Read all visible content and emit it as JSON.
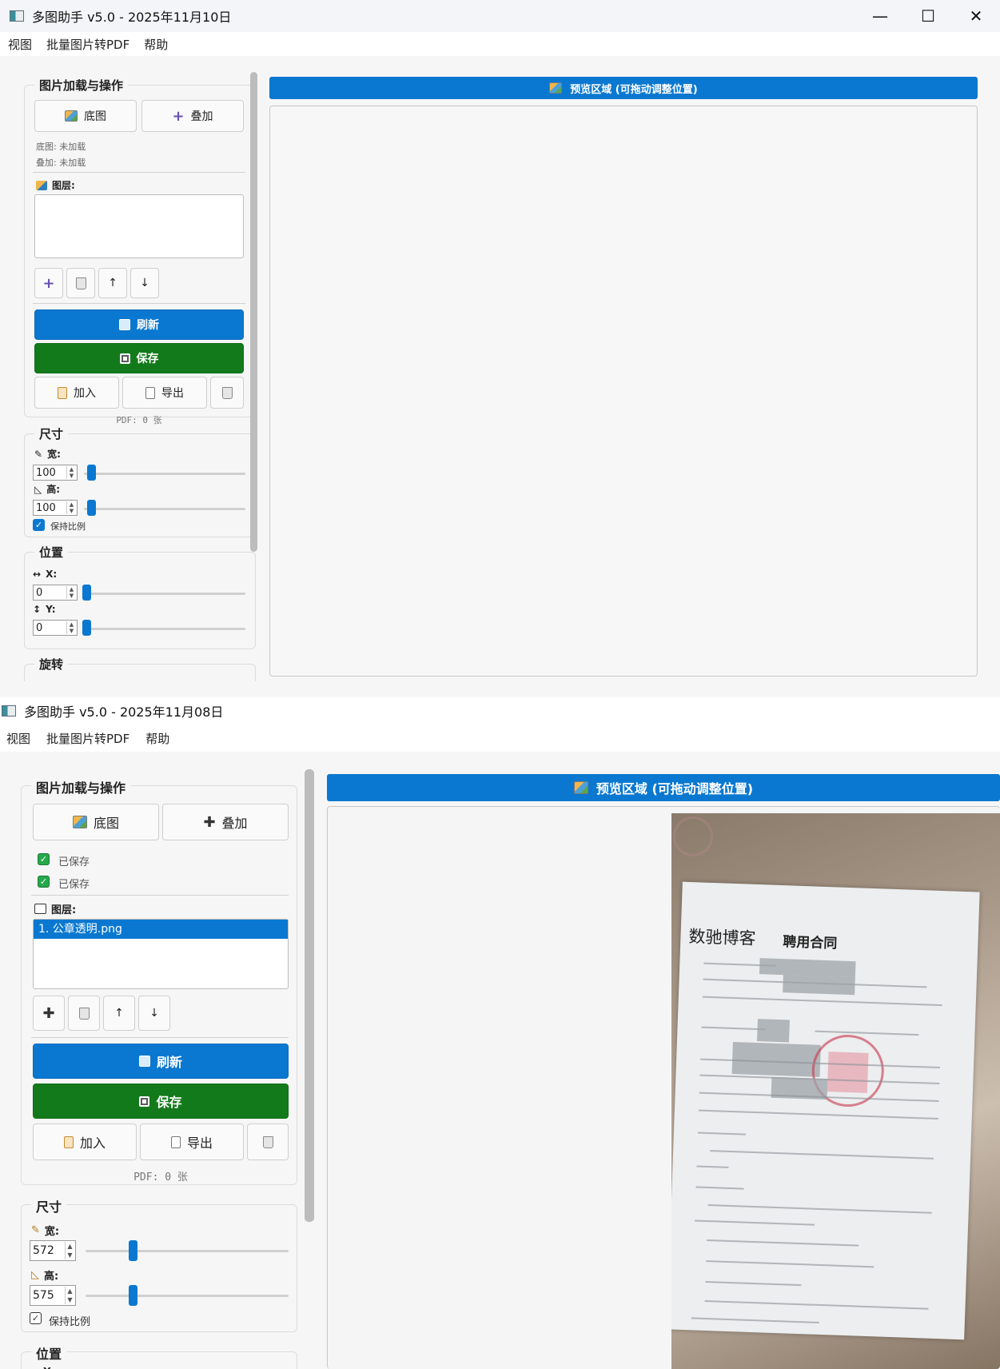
{
  "top": {
    "title": "多图助手 v5.0 - 2025年11月10日",
    "menu": [
      "视图",
      "批量图片转PDF",
      "帮助"
    ],
    "group_load": "图片加载与操作",
    "btn_base": "底图",
    "btn_overlay": "叠加",
    "status_base": "底图: 未加载",
    "status_overlay": "叠加: 未加载",
    "layers_label": "图层:",
    "btn_refresh": "刷新",
    "btn_save": "保存",
    "btn_add": "加入",
    "btn_export": "导出",
    "pdf_count": "PDF: 0 张",
    "group_size": "尺寸",
    "width_label": "宽:",
    "width_value": "100",
    "height_label": "高:",
    "height_value": "100",
    "keep_ratio": "保持比例",
    "group_position": "位置",
    "x_label": "X:",
    "x_value": "0",
    "y_label": "Y:",
    "y_value": "0",
    "group_rotate": "旋转",
    "preview_title": "预览区域 (可拖动调整位置)"
  },
  "bottom": {
    "title": "多图助手 v5.0 - 2025年11月08日",
    "menu": [
      "视图",
      "批量图片转PDF",
      "帮助"
    ],
    "group_load": "图片加载与操作",
    "btn_base": "底图",
    "btn_overlay": "叠加",
    "status_base": "已保存",
    "status_overlay": "已保存",
    "layers_label": "图层:",
    "layers": [
      "1. 公章透明.png"
    ],
    "btn_refresh": "刷新",
    "btn_save": "保存",
    "btn_add": "加入",
    "btn_export": "导出",
    "pdf_count": "PDF: 0 张",
    "group_size": "尺寸",
    "width_label": "宽:",
    "width_value": "572",
    "height_label": "高:",
    "height_value": "575",
    "keep_ratio": "保持比例",
    "group_position": "位置",
    "x_label": "X:",
    "preview_title": "预览区域 (可拖动调整位置)",
    "document": {
      "brand": "数驰博客",
      "heading": "聘用合同"
    }
  },
  "colors": {
    "accent_blue": "#0a78d0",
    "save_green": "#137a1b"
  }
}
